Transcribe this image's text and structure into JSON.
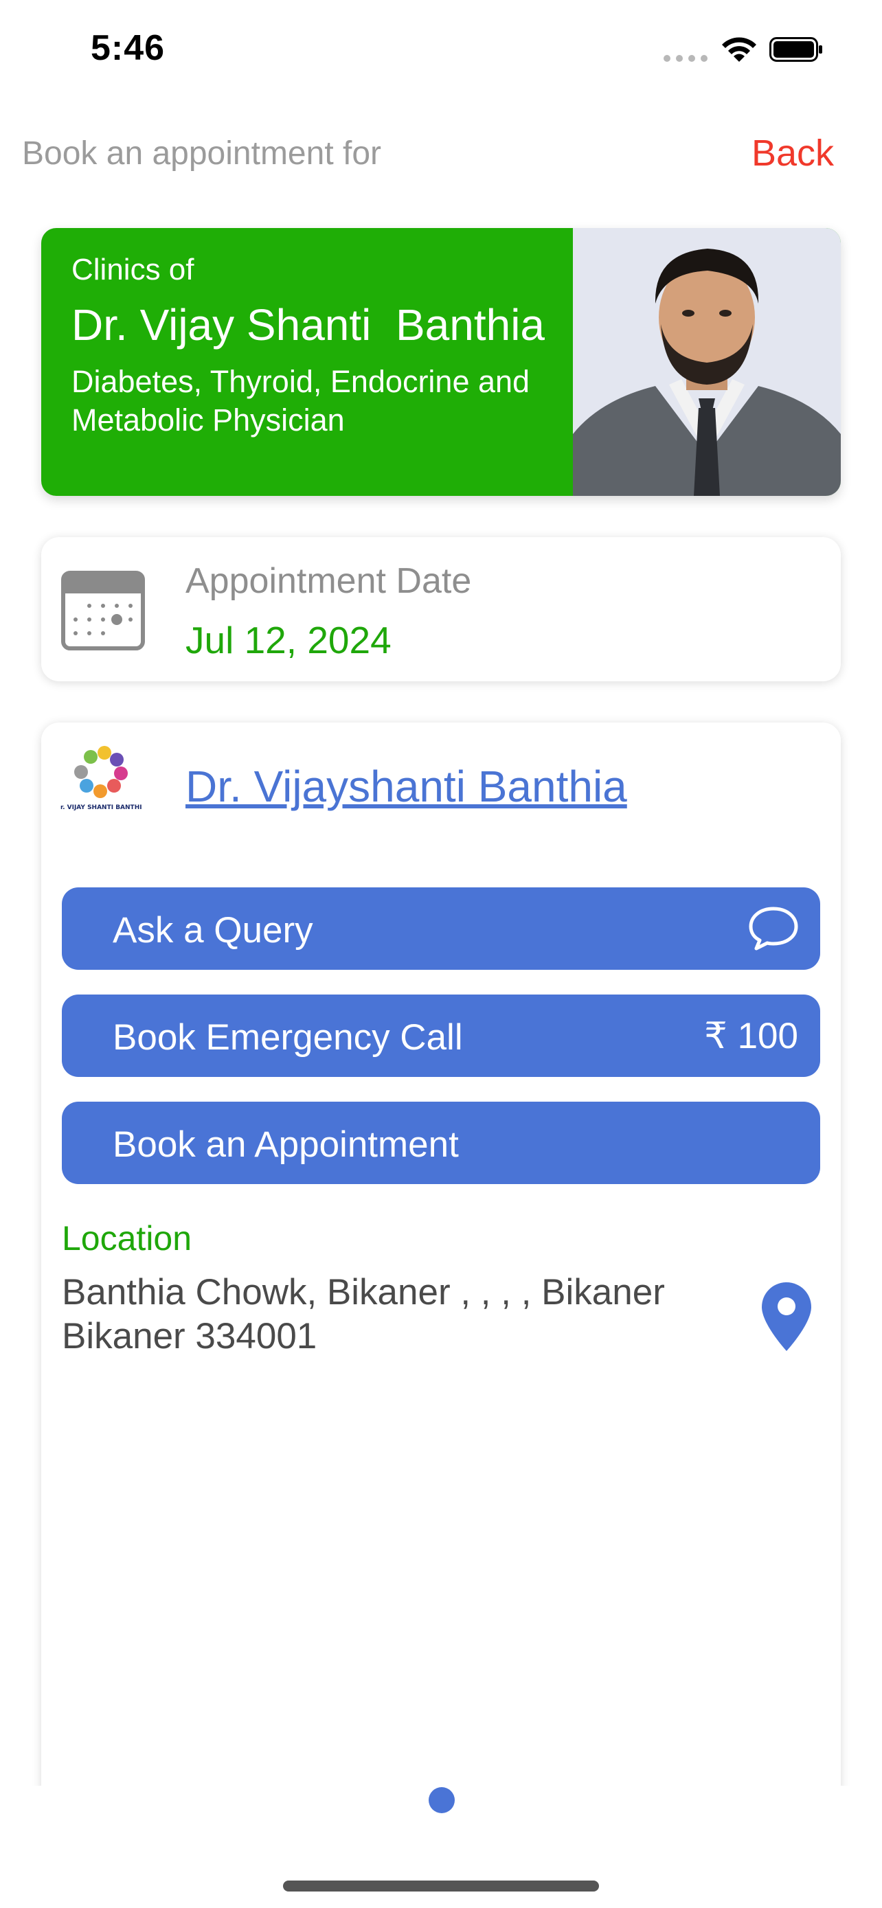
{
  "status_bar": {
    "time": "5:46"
  },
  "header": {
    "title": "Book an appointment for",
    "back_label": "Back"
  },
  "doctor_card": {
    "prefix": "Clinics of",
    "name": "Dr. Vijay Shanti  Banthia",
    "specialty": "Diabetes, Thyroid, Endocrine and Metabolic Physician",
    "background_color": "#1fae06"
  },
  "appointment": {
    "label": "Appointment Date",
    "date": "Jul 12, 2024"
  },
  "clinic": {
    "name": "Dr. Vijayshanti Banthia",
    "logo_text": "Dr. VIJAY SHANTI BANTHIA",
    "actions": {
      "query_label": "Ask a Query",
      "emergency_label": "Book Emergency Call",
      "emergency_price": "₹ 100",
      "appointment_label": "Book an Appointment"
    },
    "location_label": "Location",
    "address": "Banthia Chowk, Bikaner , , , , Bikaner Bikaner 334001"
  },
  "colors": {
    "accent_blue": "#4a74d6",
    "green": "#1fa70a",
    "back_red": "#f0392b"
  },
  "icons": [
    "wifi-icon",
    "battery-icon",
    "calendar-icon",
    "chat-bubble-icon",
    "location-pin-icon"
  ],
  "pager": {
    "pages": 1,
    "current": 1
  }
}
